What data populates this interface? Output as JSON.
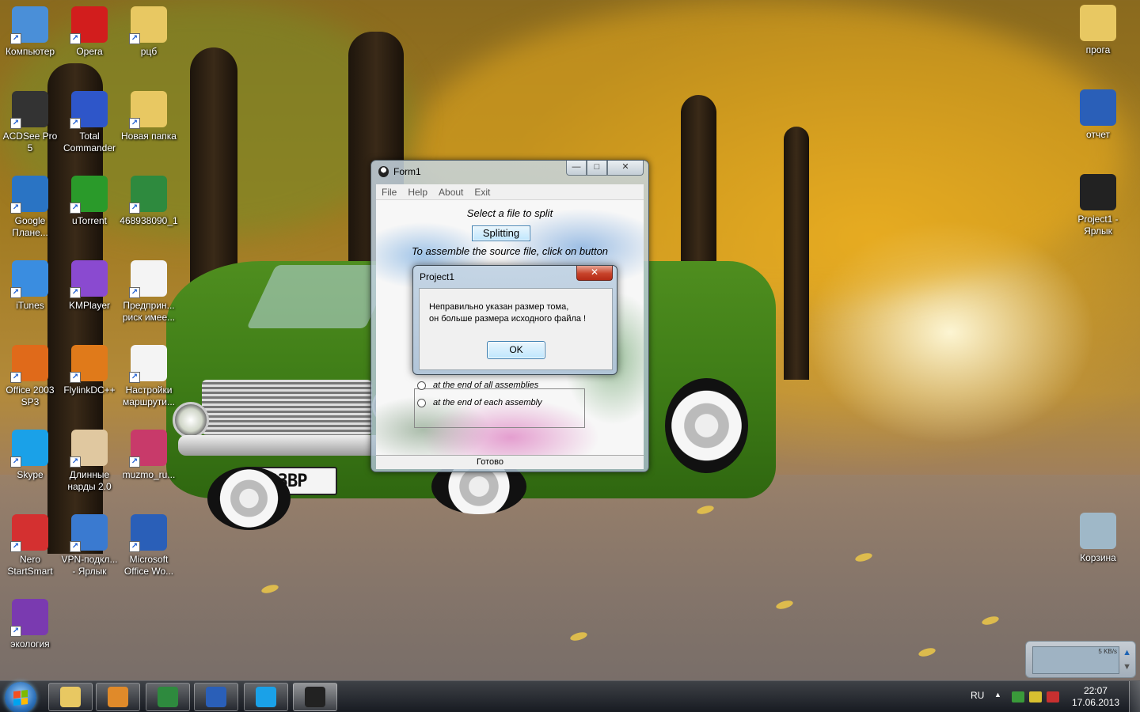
{
  "desktop": {
    "icons_left": [
      {
        "label": "Компьютер",
        "icon": "computer-icon",
        "color": "#4a8fd8"
      },
      {
        "label": "Opera",
        "icon": "opera-icon",
        "color": "#d21d1d"
      },
      {
        "label": "рцб",
        "icon": "folder-icon",
        "color": "#e8c862"
      },
      {
        "label": "ACDSee Pro 5",
        "icon": "camera-icon",
        "color": "#333333"
      },
      {
        "label": "Total Commander",
        "icon": "floppy-icon",
        "color": "#2e56c9"
      },
      {
        "label": "Новая папка",
        "icon": "folder-icon",
        "color": "#e8c862"
      },
      {
        "label": "Google Плане...",
        "icon": "globe-icon",
        "color": "#2a74c4"
      },
      {
        "label": "uTorrent",
        "icon": "utorrent-icon",
        "color": "#2a9a2a"
      },
      {
        "label": "468938090_1",
        "icon": "excel-file-icon",
        "color": "#2e8a3e"
      },
      {
        "label": "iTunes",
        "icon": "music-note-icon",
        "color": "#3a8de0"
      },
      {
        "label": "KMPlayer",
        "icon": "kmplayer-icon",
        "color": "#8a4ad0"
      },
      {
        "label": "Предприн... риск имее...",
        "icon": "document-icon",
        "color": "#f4f4f4"
      },
      {
        "label": "Office 2003 SP3",
        "icon": "office-icon",
        "color": "#e06a1a"
      },
      {
        "label": "FlylinkDC++",
        "icon": "flylink-icon",
        "color": "#e07a1a"
      },
      {
        "label": "Настройки маршрути...",
        "icon": "document-icon",
        "color": "#f4f4f4"
      },
      {
        "label": "Skype",
        "icon": "skype-icon",
        "color": "#1aa1e8"
      },
      {
        "label": "Длинные нарды 2.0",
        "icon": "dice-icon",
        "color": "#e0c8a0"
      },
      {
        "label": "muzmo_ru...",
        "icon": "mp3-icon",
        "color": "#c83a6a"
      },
      {
        "label": "Nero StartSmart",
        "icon": "nero-icon",
        "color": "#d43030"
      },
      {
        "label": "VPN-подкл... - Ярлык",
        "icon": "network-icon",
        "color": "#3a7ad0"
      },
      {
        "label": "Microsoft Office Wo...",
        "icon": "word-icon",
        "color": "#2a5fb8"
      },
      {
        "label": "экология",
        "icon": "winrar-icon",
        "color": "#7a3ab0"
      }
    ],
    "icons_right": [
      {
        "label": "прога",
        "icon": "folder-icon",
        "color": "#e8c862"
      },
      {
        "label": "отчет",
        "icon": "word-doc-icon",
        "color": "#2a5fb8"
      },
      {
        "label": "Project1 - Ярлык",
        "icon": "penguin-icon",
        "color": "#222222"
      },
      {
        "label": "Корзина",
        "icon": "recycle-bin-icon",
        "color": "#9fb8c8"
      }
    ]
  },
  "window": {
    "title": "Form1",
    "menu": [
      "File",
      "Help",
      "About",
      "Exit"
    ],
    "select_heading": "Select a file to split",
    "split_button": "Splitting",
    "assemble_heading": "To assemble the source file, click on button",
    "option_all": "at the end of all assemblies",
    "option_each": "at the end of each assembly",
    "status": "Готово"
  },
  "dialog": {
    "title": "Project1",
    "message_line1": "Неправильно указан размер тома,",
    "message_line2": "он больше размера исходного файла !",
    "ok_label": "OK"
  },
  "gadget": {
    "speed": "5 KB/s"
  },
  "taskbar": {
    "apps": [
      {
        "name": "explorer",
        "icon": "folder-icon",
        "color": "#e8c862"
      },
      {
        "name": "media-player",
        "icon": "media-player-icon",
        "color": "#e08a2a"
      },
      {
        "name": "excel",
        "icon": "excel-icon",
        "color": "#2e8a3e"
      },
      {
        "name": "word",
        "icon": "word-icon",
        "color": "#2a5fb8"
      },
      {
        "name": "skype",
        "icon": "skype-icon",
        "color": "#1aa1e8"
      },
      {
        "name": "project1",
        "icon": "penguin-icon",
        "color": "#222222"
      }
    ],
    "language": "RU",
    "time": "22:07",
    "date": "17.06.2013"
  }
}
